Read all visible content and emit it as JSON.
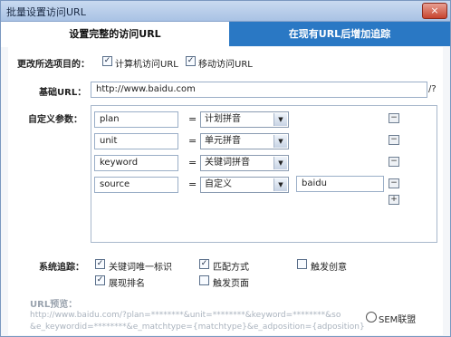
{
  "window": {
    "title": "批量设置访问URL",
    "close_glyph": "×"
  },
  "tabs": [
    {
      "label": "设置完整的访问URL",
      "active": true
    },
    {
      "label": "在现有URL后增加追踪",
      "active": false
    }
  ],
  "options": {
    "label": "更改所选项目的：",
    "pc": {
      "label": "计算机访问URL",
      "checked": true
    },
    "mobile": {
      "label": "移动访问URL",
      "checked": true
    }
  },
  "base": {
    "label": "基础URL：",
    "value": "http://www.baidu.com",
    "suffix": "/?"
  },
  "params": {
    "label": "自定义参数：",
    "eq": "=",
    "rows": [
      {
        "name": "plan",
        "value": "计划拼音",
        "extra": ""
      },
      {
        "name": "unit",
        "value": "单元拼音",
        "extra": ""
      },
      {
        "name": "keyword",
        "value": "关键词拼音",
        "extra": ""
      },
      {
        "name": "source",
        "value": "自定义",
        "extra": "baidu"
      }
    ],
    "remove_glyph": "−",
    "add_glyph": "+"
  },
  "tracking": {
    "label": "系统追踪：",
    "items": [
      {
        "label": "关键词唯一标识",
        "checked": true
      },
      {
        "label": "匹配方式",
        "checked": true
      },
      {
        "label": "触发创意",
        "checked": false
      },
      {
        "label": "展现排名",
        "checked": true
      },
      {
        "label": "触发页面",
        "checked": false
      }
    ]
  },
  "preview": {
    "label": "URL预览：",
    "line1": "http://www.baidu.com/?plan=********&unit=********&keyword=********&so",
    "line2": "&e_keywordid=********&e_matchtype={matchtype}&e_adposition={adposition}"
  },
  "watermark": {
    "text": "SEM联盟"
  },
  "colors": {
    "tab_active_bg": "#ffffff",
    "tab_inactive_bg": "#2a78c4",
    "preview_text": "#aab3be"
  }
}
